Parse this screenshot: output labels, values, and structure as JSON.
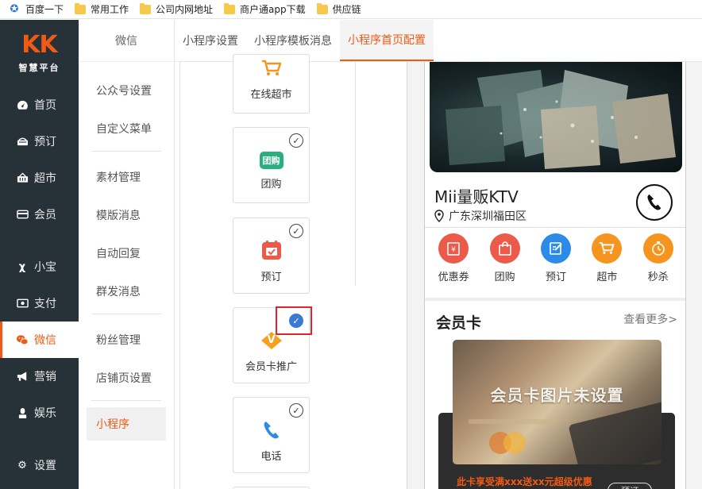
{
  "bookmarks": [
    {
      "label": "百度一下",
      "icon": "baidu-paw-icon"
    },
    {
      "label": "常用工作",
      "icon": "folder-icon"
    },
    {
      "label": "公司内网地址",
      "icon": "folder-icon"
    },
    {
      "label": "商户通app下载",
      "icon": "folder-icon"
    },
    {
      "label": "供应链",
      "icon": "folder-icon"
    }
  ],
  "logo": {
    "mark": "KK",
    "subtitle": "智慧平台"
  },
  "nav": {
    "items": [
      {
        "label": "首页",
        "icon": "dashboard-icon"
      },
      {
        "label": "预订",
        "icon": "reservation-icon"
      },
      {
        "label": "超市",
        "icon": "basket-icon"
      },
      {
        "label": "会员",
        "icon": "card-icon"
      },
      {
        "label": "小宝",
        "icon": "xiaobao-icon"
      },
      {
        "label": "支付",
        "icon": "payment-icon"
      },
      {
        "label": "微信",
        "icon": "wechat-icon",
        "active": true
      },
      {
        "label": "营销",
        "icon": "megaphone-icon"
      },
      {
        "label": "娱乐",
        "icon": "entertainment-icon"
      },
      {
        "label": "设置",
        "icon": "settings-icon"
      }
    ]
  },
  "submenu": {
    "header": "微信",
    "groups": [
      [
        "公众号设置",
        "自定义菜单"
      ],
      [
        "素材管理",
        "模版消息",
        "自动回复",
        "群发消息"
      ],
      [
        "粉丝管理",
        "店铺页设置"
      ],
      [
        "小程序"
      ]
    ],
    "active": "小程序"
  },
  "tabs": [
    "小程序设置",
    "小程序模板消息",
    "小程序首页配置"
  ],
  "active_tab": "小程序首页配置",
  "widgets": [
    {
      "label": "在线超市",
      "icon": "cart-icon",
      "checked": false
    },
    {
      "label": "团购",
      "icon": "groupbuy-icon",
      "icon_text": "团购",
      "checked": true
    },
    {
      "label": "预订",
      "icon": "reservation-icon",
      "checked": true
    },
    {
      "label": "会员卡推广",
      "icon": "vip-icon",
      "icon_text": "V",
      "checked": true,
      "highlighted": true
    },
    {
      "label": "电话",
      "icon": "phone-icon",
      "checked": true
    }
  ],
  "preview": {
    "shop_name": "Mii量贩KTV",
    "address": "广东深圳福田区",
    "quick_links": [
      {
        "label": "优惠券",
        "icon": "coupon-icon",
        "color": "#ec5a4a"
      },
      {
        "label": "团购",
        "icon": "bag-icon",
        "color": "#ec5a4a"
      },
      {
        "label": "预订",
        "icon": "edit-icon",
        "color": "#2d8be8"
      },
      {
        "label": "超市",
        "icon": "cart-icon",
        "color": "#f5951f"
      },
      {
        "label": "秒杀",
        "icon": "stopwatch-icon",
        "color": "#f5951f"
      }
    ],
    "member_card": {
      "title": "会员卡",
      "more": "查看更多>",
      "placeholder": "会员卡图片未设置",
      "promo": "此卡享受满xxx送xx元超级优惠",
      "button": "预订"
    }
  },
  "colors": {
    "accent": "#f05a14",
    "sidebar_bg": "#273238",
    "highlight_box": "#e5222b",
    "check_blue": "#3a7bd5"
  }
}
